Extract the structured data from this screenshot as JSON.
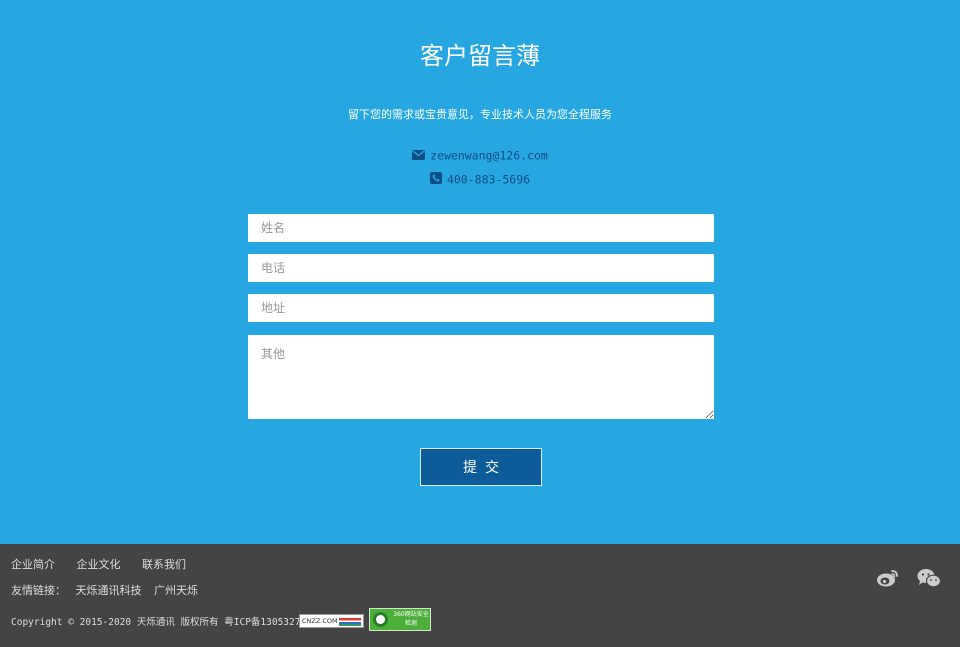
{
  "page": {
    "title": "客户留言薄",
    "subtitle": "留下您的需求或宝贵意见，专业技术人员为您全程服务"
  },
  "contact": {
    "email": "zewenwang@126.com",
    "email_icon": "envelope-icon",
    "phone": "400-883-5696",
    "phone_icon": "phone-icon"
  },
  "form": {
    "name_placeholder": "姓名",
    "phone_placeholder": "电话",
    "address_placeholder": "地址",
    "other_placeholder": "其他",
    "submit_label": "提交"
  },
  "footer": {
    "nav": [
      "企业简介",
      "企业文化",
      "联系我们"
    ],
    "links_label": "友情链接：",
    "links": [
      "天烁通讯科技",
      "广州天烁"
    ],
    "copyright": "Copyright © 2015-2020 天烁通讯 版权所有 粤ICP备13053276号",
    "cnzz_badge": "CNZZ.COM",
    "security_badge": "360网站安全检测",
    "social_icons": [
      "weibo-icon",
      "wechat-icon"
    ]
  },
  "colors": {
    "background": "#26a7e1",
    "button": "#0d5c99",
    "contact_text": "#0d4f86",
    "footer": "#444444"
  }
}
